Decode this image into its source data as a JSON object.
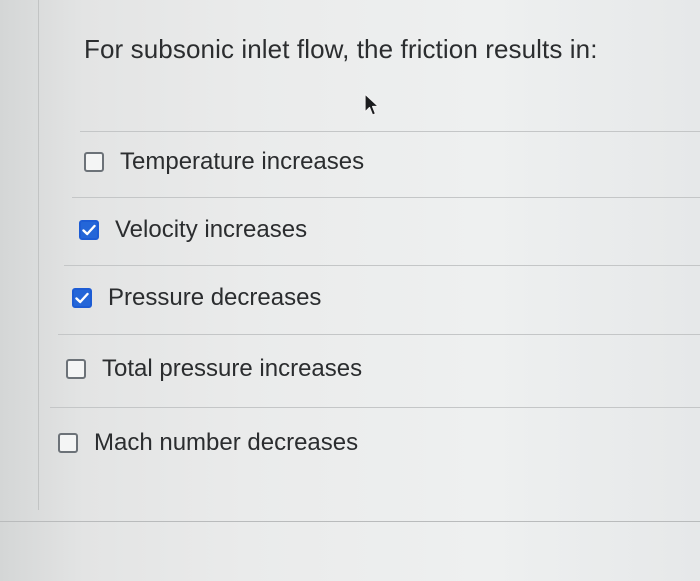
{
  "question": {
    "text": "For subsonic inlet flow, the friction results in:"
  },
  "options": [
    {
      "label": "Temperature increases",
      "checked": false
    },
    {
      "label": "Velocity increases",
      "checked": true
    },
    {
      "label": "Pressure decreases",
      "checked": true
    },
    {
      "label": "Total pressure increases",
      "checked": false
    },
    {
      "label": "Mach number decreases",
      "checked": false
    }
  ],
  "colors": {
    "checked_fill": "#2466d8",
    "unchecked_border": "#6c7278",
    "text": "#2b2d2f"
  },
  "icons": {
    "cursor": "mouse-pointer-icon",
    "check": "checkmark-icon"
  }
}
